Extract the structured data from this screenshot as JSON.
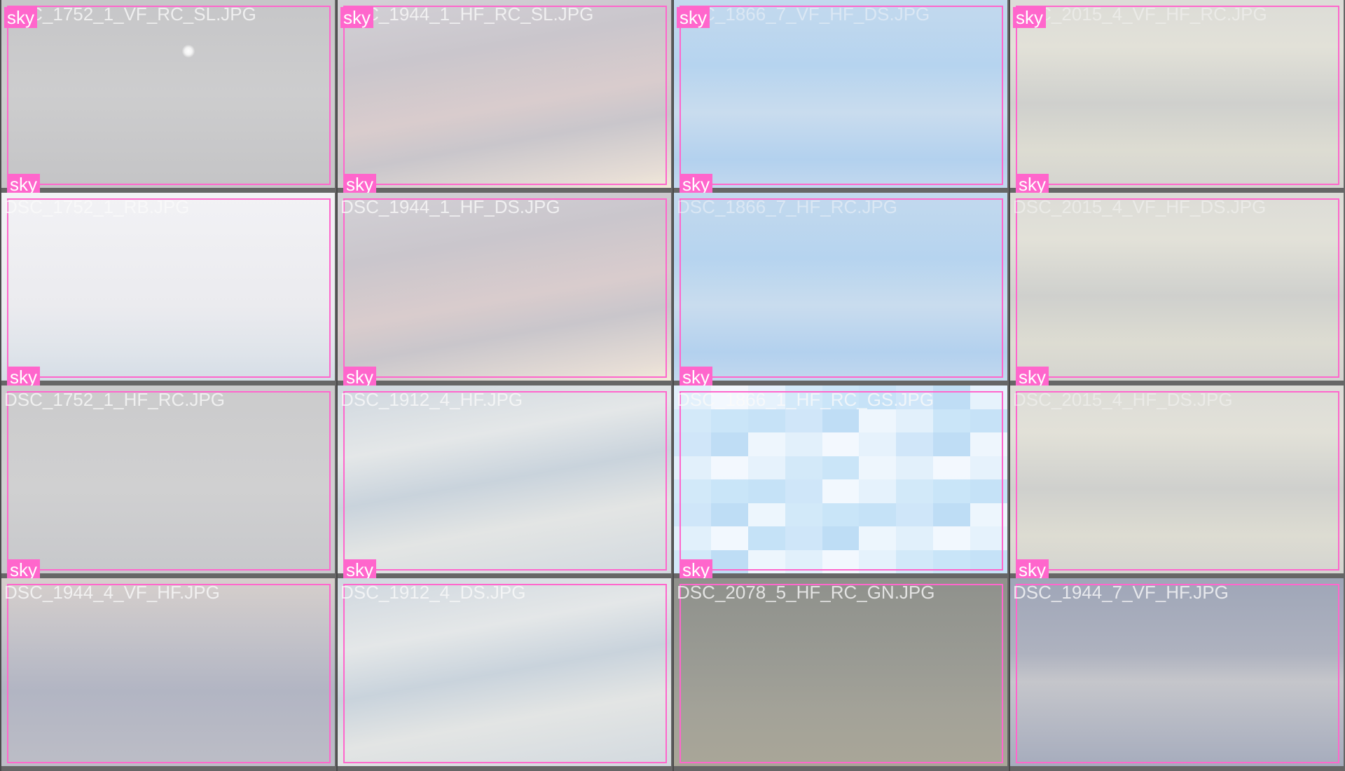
{
  "gallery": {
    "tiles": [
      {
        "filename": "DSC_1752_1_VF_RC_SL.JPG",
        "label_top": "sky",
        "label_bottom": "sky",
        "base_color": "#cbcbcc",
        "tone": "grey-sun"
      },
      {
        "filename": "DSC_1944_1_HF_RC_SL.JPG",
        "label_top": "sky",
        "label_bottom": "sky",
        "base_color": "#cfcdd0",
        "tone": "pink-streak"
      },
      {
        "filename": "DSC_1866_7_VF_HF_DS.JPG",
        "label_top": "sky",
        "label_bottom": "sky",
        "base_color": "#b9d6ef",
        "tone": "blue"
      },
      {
        "filename": "DSC_2015_4_VF_HF_RC.JPG",
        "label_top": "sky",
        "label_bottom": "sky",
        "base_color": "#d9dad6",
        "tone": "pale"
      },
      {
        "filename": "DSC_1752_1_RB.JPG",
        "label_top": "",
        "label_bottom": "sky",
        "base_color": "#eeeef1",
        "tone": "white"
      },
      {
        "filename": "DSC_1944_1_HF_DS.JPG",
        "label_top": "",
        "label_bottom": "sky",
        "base_color": "#c9c6ca",
        "tone": "pink-streak"
      },
      {
        "filename": "DSC_1866_7_HF_RC.JPG",
        "label_top": "",
        "label_bottom": "sky",
        "base_color": "#b9d6ef",
        "tone": "blue"
      },
      {
        "filename": "DSC_2015_4_VF_HF_DS.JPG",
        "label_top": "",
        "label_bottom": "sky",
        "base_color": "#d6d7d2",
        "tone": "pale"
      },
      {
        "filename": "DSC_1752_1_HF_RC.JPG",
        "label_top": "",
        "label_bottom": "sky",
        "base_color": "#cfcfd0",
        "tone": "grey"
      },
      {
        "filename": "DSC_1912_4_HF.JPG",
        "label_top": "",
        "label_bottom": "sky",
        "base_color": "#d5dbe0",
        "tone": "cloudy"
      },
      {
        "filename": "DSC_1866_1_HF_RC_GS.JPG",
        "label_top": "",
        "label_bottom": "sky",
        "base_color": "#cfe6f7",
        "tone": "mosaic"
      },
      {
        "filename": "DSC_2015_4_HF_DS.JPG",
        "label_top": "",
        "label_bottom": "sky",
        "base_color": "#d3d4cf",
        "tone": "pale"
      },
      {
        "filename": "DSC_1944_4_VF_HF.JPG",
        "label_top": "",
        "label_bottom": "",
        "base_color": "#b9bbc6",
        "tone": "grey-dusk"
      },
      {
        "filename": "DSC_1912_4_DS.JPG",
        "label_top": "",
        "label_bottom": "",
        "base_color": "#dde3e6",
        "tone": "cloudy"
      },
      {
        "filename": "DSC_2078_5_HF_RC_GN.JPG",
        "label_top": "",
        "label_bottom": "",
        "base_color": "#9c9c94",
        "tone": "dark"
      },
      {
        "filename": "DSC_1944_7_VF_HF.JPG",
        "label_top": "",
        "label_bottom": "",
        "base_color": "#a9afbf",
        "tone": "slate"
      }
    ]
  },
  "colors": {
    "background": "#666666",
    "bbox": "#ff66cc",
    "label_text": "#ffffff"
  }
}
